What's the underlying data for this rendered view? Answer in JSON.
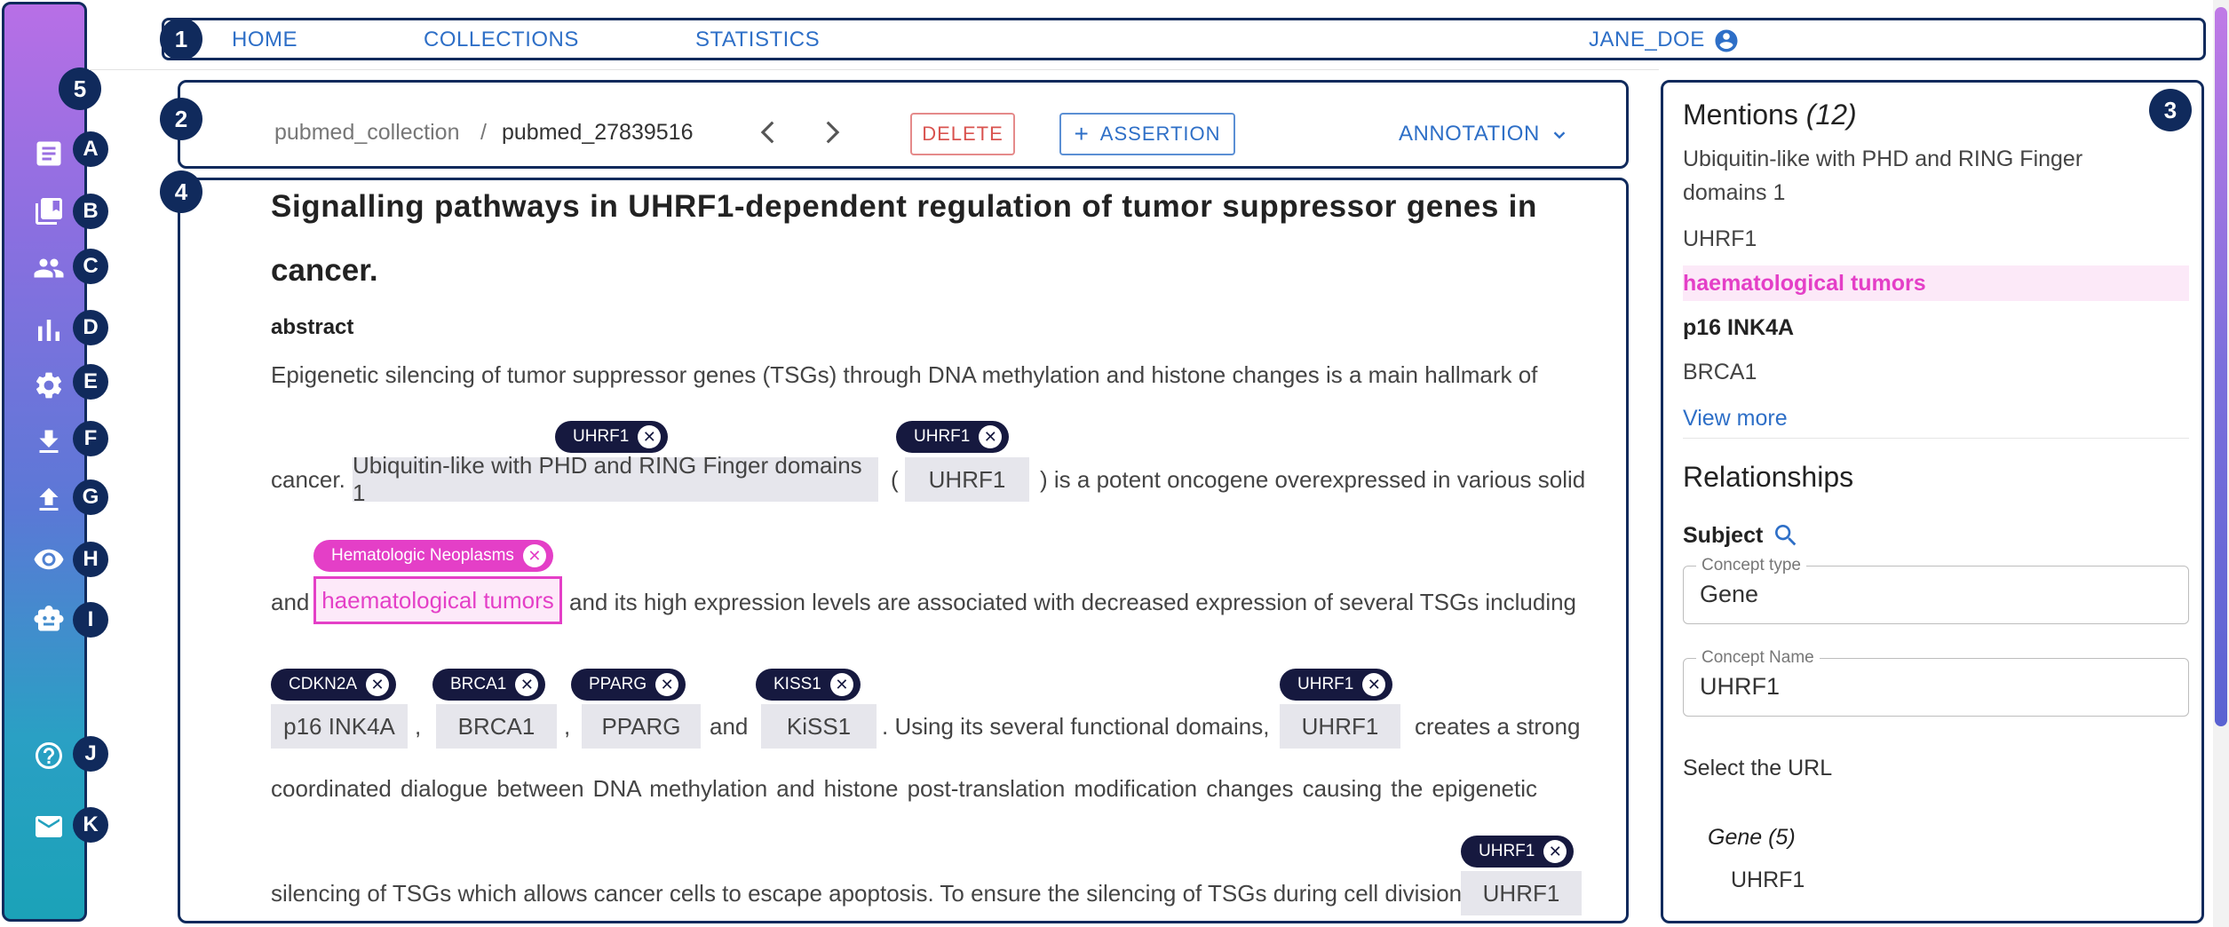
{
  "nav": {
    "home": "HOME",
    "collections": "COLLECTIONS",
    "statistics": "STATISTICS",
    "user": "JANE_DOE"
  },
  "callouts": {
    "c1": "1",
    "c2": "2",
    "c3": "3",
    "c4": "4",
    "c5": "5",
    "a": "A",
    "b": "B",
    "c": "C",
    "d": "D",
    "e": "E",
    "f": "F",
    "g": "G",
    "h": "H",
    "i": "I",
    "j": "J",
    "k": "K"
  },
  "sidebar_icons": [
    "document-icon",
    "collections-icon",
    "users-icon",
    "statistics-icon",
    "settings-icon",
    "download-icon",
    "upload-icon",
    "eye-icon",
    "robot-icon",
    "help-icon",
    "mail-icon"
  ],
  "doc_header": {
    "collection": "pubmed_collection",
    "separator": "/",
    "document": "pubmed_27839516",
    "delete_label": "DELETE",
    "assertion_label": "ASSERTION",
    "assertion_plus": "+",
    "annotation_label": "ANNOTATION"
  },
  "document": {
    "title_line1": "Signalling pathways in UHRF1-dependent regulation of tumor suppressor genes in",
    "title_line2": "cancer.",
    "section": "abstract",
    "line1": "Epigenetic silencing of tumor suppressor genes (TSGs) through DNA methylation and histone changes is a main hallmark of",
    "line2": {
      "pre": "cancer.",
      "ent1": "Ubiquitin-like with PHD and RING Finger domains 1",
      "paren_open": "(",
      "ent2": "UHRF1",
      "post": ") is a potent oncogene overexpressed in various solid",
      "chip1": "UHRF1",
      "chip2": "UHRF1"
    },
    "line3": {
      "pre": "and",
      "ent": "haematological tumors",
      "post": "and its high expression levels are associated with decreased expression of several TSGs including",
      "chip": "Hematologic Neoplasms"
    },
    "line4": {
      "ent1": "p16 INK4A",
      "comma1": ",",
      "ent2": "BRCA1",
      "comma2": ",",
      "ent3": "PPARG",
      "and": "and",
      "ent4": "KiSS1",
      "mid": ". Using its several functional domains,",
      "ent5": "UHRF1",
      "post": "creates a strong",
      "chip1": "CDKN2A",
      "chip2": "BRCA1",
      "chip3": "PPARG",
      "chip4": "KISS1",
      "chip5": "UHRF1"
    },
    "line5": "coordinated dialogue between DNA methylation and histone post-translation modification changes causing the epigenetic",
    "line6": {
      "pre": "silencing of TSGs which allows cancer cells to escape apoptosis. To ensure the silencing of TSGs during cell division,",
      "ent": "UHRF1",
      "chip": "UHRF1"
    },
    "chip_close": "✕"
  },
  "right_panel": {
    "mentions_title": "Mentions",
    "mentions_count": "(12)",
    "mentions": [
      "Ubiquitin-like with PHD and RING Finger",
      "domains 1",
      "UHRF1",
      "haematological tumors",
      "p16 INK4A",
      "BRCA1"
    ],
    "view_more": "View more",
    "relationships_title": "Relationships",
    "subject_label": "Subject",
    "concept_type_label": "Concept type",
    "concept_type_value": "Gene",
    "concept_name_label": "Concept Name",
    "concept_name_value": "UHRF1",
    "select_url": "Select the URL",
    "gene_group": "Gene (5)",
    "gene_item": "UHRF1"
  },
  "colors": {
    "accent_blue": "#2e6fc7",
    "callout_navy": "#102a5c",
    "chip_navy": "#16193f",
    "highlight_pink": "#e43fc7",
    "delete_red": "#d9534f"
  }
}
